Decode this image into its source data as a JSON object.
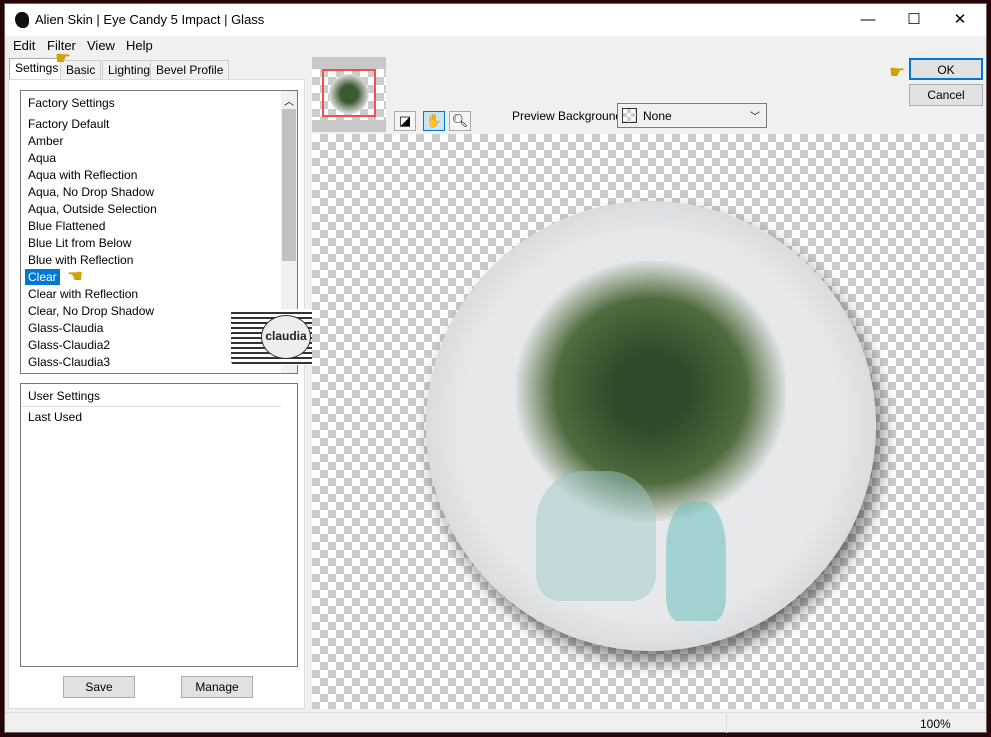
{
  "window": {
    "title": "Alien Skin | Eye Candy 5 Impact | Glass",
    "controls": {
      "minimize": "—",
      "maximize": "☐",
      "close": "✕"
    }
  },
  "menu": [
    "Edit",
    "Filter",
    "View",
    "Help"
  ],
  "tabs": [
    {
      "label": "Settings",
      "active": true
    },
    {
      "label": "Basic"
    },
    {
      "label": "Lighting"
    },
    {
      "label": "Bevel Profile"
    }
  ],
  "factory_settings": {
    "header": "Factory Settings",
    "items": [
      "Factory Default",
      "Amber",
      "Aqua",
      "Aqua with Reflection",
      "Aqua, No Drop Shadow",
      "Aqua, Outside Selection",
      "Blue Flattened",
      "Blue Lit from Below",
      "Blue with Reflection",
      "Clear",
      "Clear with Reflection",
      "Clear, No Drop Shadow",
      "Glass-Claudia",
      "Glass-Claudia2",
      "Glass-Claudia3"
    ],
    "selected": "Clear"
  },
  "user_settings": {
    "header": "User Settings",
    "items": [
      "Last Used"
    ]
  },
  "buttons": {
    "save": "Save",
    "manage": "Manage",
    "ok": "OK",
    "cancel": "Cancel"
  },
  "preview_background": {
    "label": "Preview Background:",
    "value": "None"
  },
  "toolbar": [
    "preview-color-icon",
    "hand-icon",
    "zoom-icon"
  ],
  "status": {
    "zoom": "100%"
  },
  "watermark": "claudia",
  "colors": {
    "selection": "#0078d7",
    "ok_border": "#0078d7",
    "thumb_frame": "#f05050"
  }
}
